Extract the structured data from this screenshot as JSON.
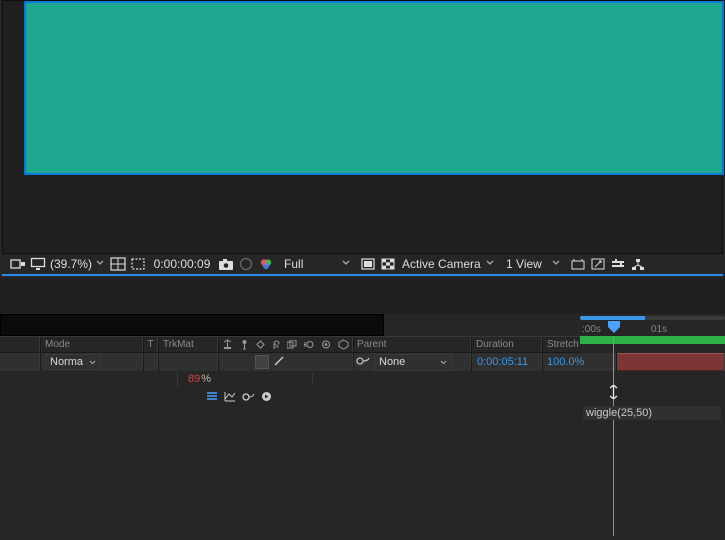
{
  "preview": {
    "zoom": "(39.7%)",
    "timecode": "0:00:00:09",
    "resolution": "Full",
    "camera": "Active Camera",
    "view": "1 View"
  },
  "columns": {
    "mode": "Mode",
    "t": "T",
    "trkmat": "TrkMat",
    "parent": "Parent",
    "duration": "Duration",
    "stretch": "Stretch"
  },
  "layer": {
    "mode": "Norma",
    "parent": "None",
    "duration": "0:00:05:11",
    "stretch": "100.0%"
  },
  "property": {
    "value": "89",
    "suffix": "%"
  },
  "expression": "wiggle(25,50)",
  "ruler": {
    "label_start": ":00s",
    "label_01s": "01s"
  }
}
